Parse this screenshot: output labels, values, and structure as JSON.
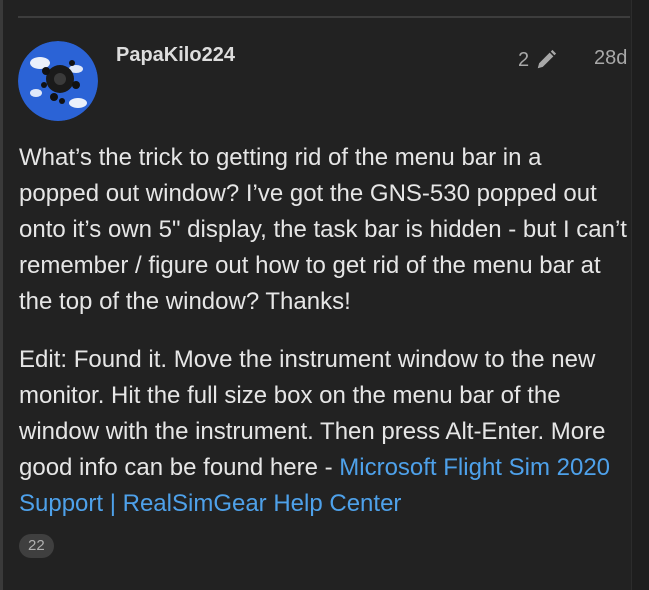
{
  "post": {
    "username": "PapaKilo224",
    "edit_count": "2",
    "age": "28d",
    "paragraph_1": "What’s the trick to getting rid of the menu bar in a popped out window? I’ve got the GNS-530 popped out onto it’s own 5\" display, the task bar is hidden - but I can’t remember / figure out how to get rid of the menu bar at the top of the window? Thanks!",
    "paragraph_2_text": "Edit: Found it. Move the instrument window to the new monitor. Hit the full size box on the menu bar of the window with the instrument. Then press Alt-Enter. More good info can be found here - ",
    "link_text": "Microsoft Flight Sim 2020 Support | RealSimGear Help Center",
    "link_click_count": "22"
  },
  "icons": {
    "avatar": "user-avatar",
    "edit": "pencil-icon"
  },
  "colors": {
    "background": "#222222",
    "text": "#e6e6e6",
    "muted": "#a8a8a8",
    "link": "#4ea1ea",
    "avatar_bg": "#2b63d6"
  }
}
